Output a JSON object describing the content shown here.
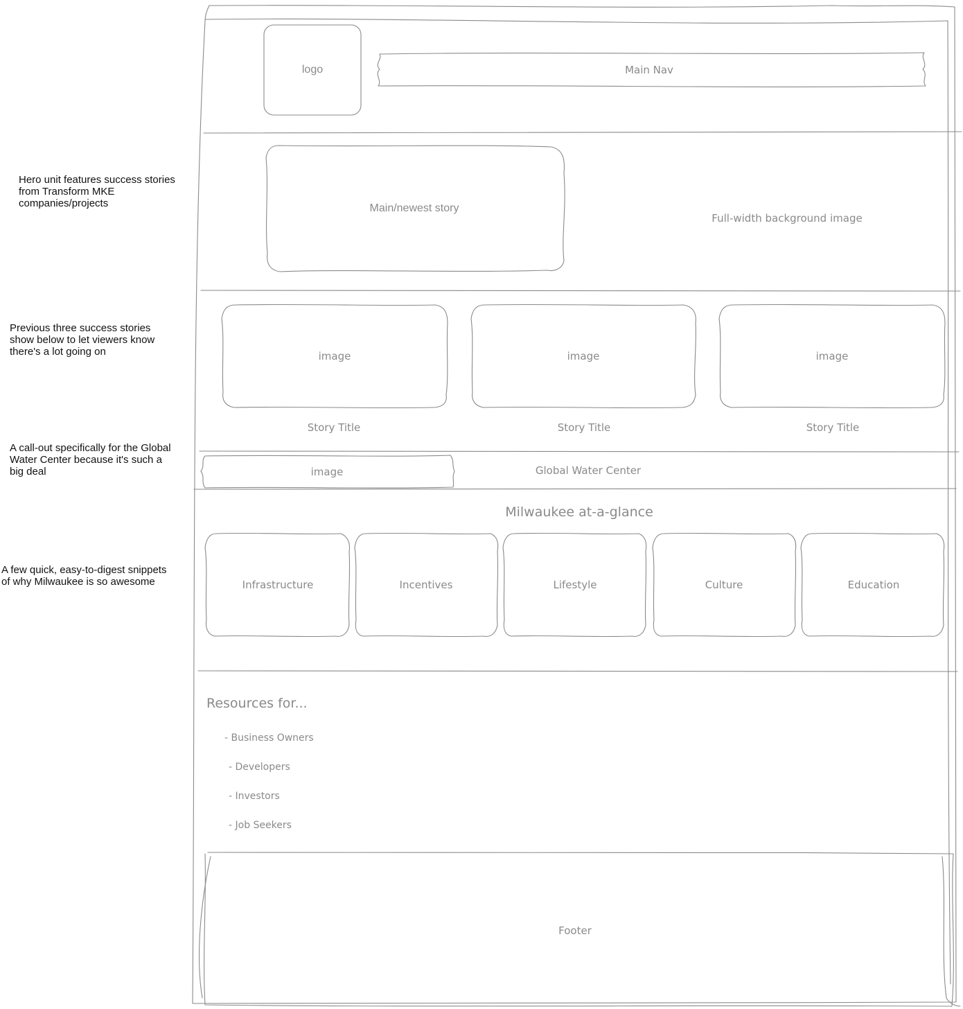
{
  "annotations": {
    "hero_note": "Hero unit features success stories from Transform MKE companies/projects",
    "stories_note": "Previous three success stories show below to let viewers know there's a lot going on",
    "water_note": "A call-out specifically for the Global Water Center because it's such a big deal",
    "glance_note": "A few quick, easy-to-digest snippets of why Milwaukee is so awesome"
  },
  "header": {
    "logo": "logo",
    "main_nav": "Main Nav"
  },
  "hero": {
    "main_story": "Main/newest story",
    "background": "Full-width background image"
  },
  "stories": [
    {
      "image": "image",
      "title": "Story Title"
    },
    {
      "image": "image",
      "title": "Story Title"
    },
    {
      "image": "image",
      "title": "Story Title"
    }
  ],
  "water_callout": {
    "image": "image",
    "title": "Global Water Center"
  },
  "glance": {
    "title": "Milwaukee at-a-glance",
    "items": [
      "Infrastructure",
      "Incentives",
      "Lifestyle",
      "Culture",
      "Education"
    ]
  },
  "resources": {
    "title": "Resources for...",
    "items": [
      "- Business Owners",
      "- Developers",
      "- Investors",
      "- Job Seekers"
    ]
  },
  "footer": {
    "label": "Footer"
  }
}
